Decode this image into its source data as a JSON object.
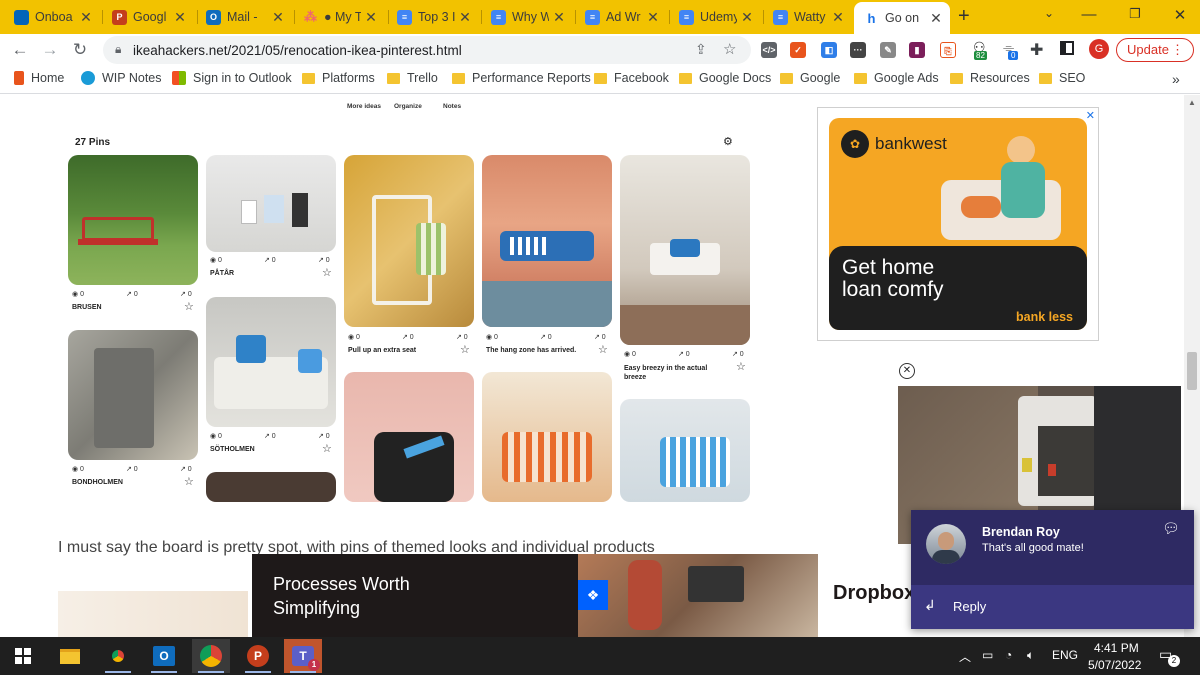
{
  "tabs": [
    {
      "title": "Onboa",
      "icon": "onedrive-icon",
      "color": "#0364b8"
    },
    {
      "title": "Googl",
      "icon": "powerpoint-icon",
      "color": "#c43e1c"
    },
    {
      "title": "Mail -",
      "icon": "outlook-icon",
      "color": "#0f6cbd"
    },
    {
      "title": "● My T",
      "icon": "asana-icon",
      "color": "#f06a6a"
    },
    {
      "title": "Top 3 I",
      "icon": "google-docs-icon",
      "color": "#4285f4"
    },
    {
      "title": "Why W",
      "icon": "google-docs-icon",
      "color": "#4285f4"
    },
    {
      "title": "Ad Wr",
      "icon": "google-docs-icon",
      "color": "#4285f4"
    },
    {
      "title": "Udemy",
      "icon": "google-docs-icon",
      "color": "#4285f4"
    },
    {
      "title": "Watty",
      "icon": "google-docs-icon",
      "color": "#4285f4"
    },
    {
      "title": "Go on",
      "icon": "ikeahackers-icon",
      "color": "#1a73e8",
      "active": true
    }
  ],
  "toolbar": {
    "url": "ikeahackers.net/2021/05/renocation-ikea-pinterest.html",
    "update_label": "Update",
    "ext_badge_1": "82",
    "ext_badge_2": "0",
    "profile_letter": "G"
  },
  "bookmarks": [
    {
      "label": "Home",
      "icon": "office-icon"
    },
    {
      "label": "WIP Notes",
      "icon": "notes-icon"
    },
    {
      "label": "Sign in to Outlook",
      "icon": "microsoft-icon"
    },
    {
      "label": "Platforms",
      "icon": "folder-icon"
    },
    {
      "label": "Trello",
      "icon": "folder-icon"
    },
    {
      "label": "Performance Reports",
      "icon": "folder-icon"
    },
    {
      "label": "Facebook",
      "icon": "folder-icon"
    },
    {
      "label": "Google Docs",
      "icon": "folder-icon"
    },
    {
      "label": "Google",
      "icon": "folder-icon"
    },
    {
      "label": "Google Ads",
      "icon": "folder-icon"
    },
    {
      "label": "Resources",
      "icon": "folder-icon"
    },
    {
      "label": "SEO",
      "icon": "folder-icon"
    }
  ],
  "board": {
    "top_links": [
      "More ideas",
      "Organize",
      "Notes"
    ],
    "pin_count": "27 Pins",
    "pins": [
      {
        "caption": "BRUSEN",
        "views": "0",
        "saves": "0",
        "clicks": "0"
      },
      {
        "caption": "PÅTÅR",
        "views": "0",
        "saves": "0",
        "clicks": "0"
      },
      {
        "caption": "Pull up an extra seat",
        "views": "0",
        "saves": "0",
        "clicks": "0"
      },
      {
        "caption": "The hang zone has arrived.",
        "views": "0",
        "saves": "0",
        "clicks": "0"
      },
      {
        "caption": "Easy breezy in the actual breeze",
        "views": "0",
        "saves": "0",
        "clicks": "0"
      },
      {
        "caption": "BONDHOLMEN",
        "views": "0",
        "saves": "0",
        "clicks": "0"
      },
      {
        "caption": "SÖTHOLMEN",
        "views": "0",
        "saves": "0",
        "clicks": "0"
      }
    ]
  },
  "article_text": "I must say the board is pretty spot, with pins of themed looks and individual products",
  "ad_bankwest": {
    "brand": "bankwest",
    "headline_1": "Get home",
    "headline_2": "loan comfy",
    "tagline": "bank less"
  },
  "ad_dropbox": {
    "headline_1": "Processes Worth",
    "headline_2": "Simplifying",
    "brand": "Dropbox"
  },
  "toast": {
    "sender": "Brendan Roy",
    "message": "That's all good mate!",
    "reply_label": "Reply"
  },
  "taskbar": {
    "lang": "ENG",
    "time": "4:41 PM",
    "date": "5/07/2022",
    "notif_count": "2",
    "teams_badge": "1"
  }
}
